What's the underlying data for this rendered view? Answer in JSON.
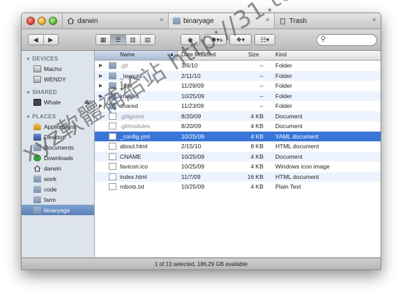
{
  "tabs": [
    {
      "label": "darwin",
      "icon": "home-icon",
      "close": "×"
    },
    {
      "label": "binaryage",
      "icon": "folder-icon",
      "close": "×"
    },
    {
      "label": "Trash",
      "icon": "trash-icon",
      "close": "×"
    }
  ],
  "toolbar": {
    "back": "◀",
    "forward": "▶",
    "view_icon": "▦",
    "view_list": "☰",
    "view_column": "▥",
    "view_coverflow": "▤",
    "quicklook": "◉",
    "action": "✱▾",
    "dropbox": "❖▾",
    "arrange": "☷▾",
    "search_icon": "⚲"
  },
  "sidebar": {
    "sections": [
      {
        "title": "DEVICES",
        "items": [
          {
            "label": "Macho",
            "icon": "hard-drive-icon"
          },
          {
            "label": "WENDY",
            "icon": "hard-drive-icon"
          }
        ]
      },
      {
        "title": "SHARED",
        "items": [
          {
            "label": "Whale",
            "icon": "computer-icon",
            "eject": "⏏"
          }
        ]
      },
      {
        "title": "PLACES",
        "items": [
          {
            "label": "Applications",
            "icon": "applications-icon"
          },
          {
            "label": "Desktop",
            "icon": "desktop-icon"
          },
          {
            "label": "Documents",
            "icon": "documents-icon"
          },
          {
            "label": "Downloads",
            "icon": "downloads-icon"
          },
          {
            "label": "darwin",
            "icon": "home-icon"
          },
          {
            "label": "work",
            "icon": "folder-icon"
          },
          {
            "label": "code",
            "icon": "folder-icon"
          },
          {
            "label": "farm",
            "icon": "folder-icon"
          },
          {
            "label": "binaryage",
            "icon": "folder-icon",
            "selected": true
          }
        ]
      }
    ]
  },
  "columns": {
    "name": "Name",
    "sort_arrow": "▲",
    "date": "Date Modified",
    "size": "Size",
    "kind": "Kind"
  },
  "files": [
    {
      "name": ".git",
      "date": "3/6/10",
      "size": "--",
      "kind": "Folder",
      "folder": true,
      "dim": true
    },
    {
      "name": "_layouts",
      "date": "2/11/10",
      "size": "--",
      "kind": "Folder",
      "folder": true
    },
    {
      "name": "_site",
      "date": "11/29/09",
      "size": "--",
      "kind": "Folder",
      "folder": true
    },
    {
      "name": "images",
      "date": "10/25/09",
      "size": "--",
      "kind": "Folder",
      "folder": true
    },
    {
      "name": "shared",
      "date": "11/23/09",
      "size": "--",
      "kind": "Folder",
      "folder": true
    },
    {
      "name": ".gitignore",
      "date": "8/20/09",
      "size": "4 KB",
      "kind": "Document",
      "dim": true
    },
    {
      "name": ".gitmodules",
      "date": "8/20/09",
      "size": "4 KB",
      "kind": "Document",
      "dim": true
    },
    {
      "name": "_config.yml",
      "date": "10/25/09",
      "size": "4 KB",
      "kind": "YAML document",
      "selected": true
    },
    {
      "name": "about.html",
      "date": "2/15/10",
      "size": "8 KB",
      "kind": "HTML document"
    },
    {
      "name": "CNAME",
      "date": "10/25/09",
      "size": "4 KB",
      "kind": "Document"
    },
    {
      "name": "favicon.ico",
      "date": "10/25/09",
      "size": "4 KB",
      "kind": "Windows icon image"
    },
    {
      "name": "index.html",
      "date": "11/7/09",
      "size": "16 KB",
      "kind": "HTML document"
    },
    {
      "name": "robots.txt",
      "date": "10/25/09",
      "size": "4 KB",
      "kind": "Plain Text"
    }
  ],
  "status": "1 of 13 selected, 186.29 GB available",
  "watermark": "xyz軟體補給站 http://31.to"
}
